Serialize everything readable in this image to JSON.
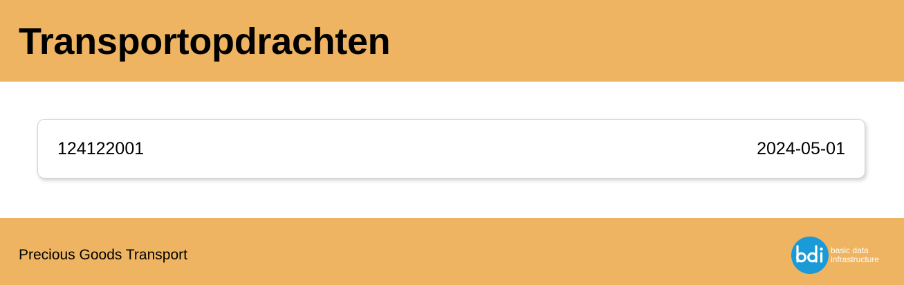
{
  "header": {
    "title": "Transportopdrachten"
  },
  "orders": [
    {
      "id": "124122001",
      "date": "2024-05-01"
    }
  ],
  "footer": {
    "company": "Precious Goods Transport",
    "logo": {
      "mark": "bdi",
      "line1": "basic data",
      "line2": "infrastructure"
    }
  },
  "colors": {
    "accent": "#eeb462",
    "logo_blue": "#1a9ad6"
  }
}
